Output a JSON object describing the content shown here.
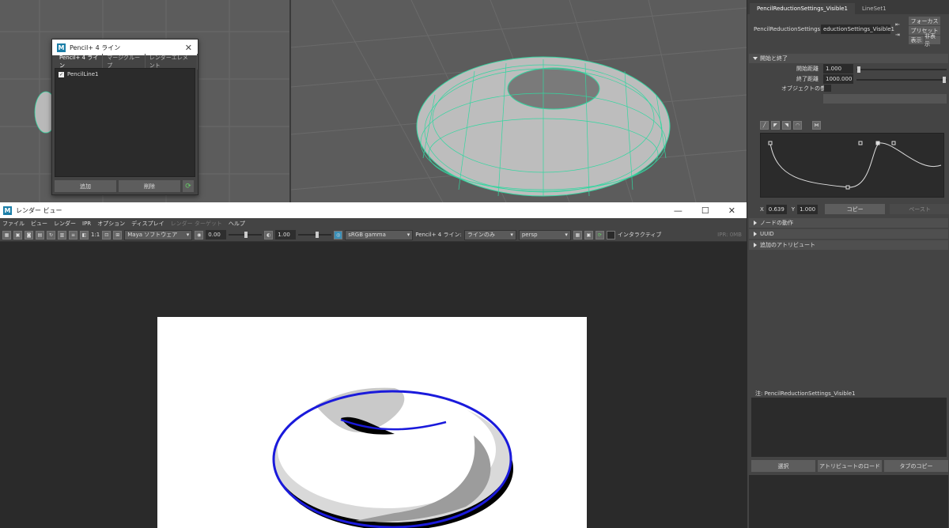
{
  "pencil_dialog": {
    "title": "Pencil+ 4 ライン",
    "tabs": [
      "Pencil+ 4 ライン",
      "マージグループ",
      "レンダーエレメント"
    ],
    "list_items": [
      {
        "label": "PencilLine1",
        "checked": true
      }
    ],
    "add_label": "追加",
    "delete_label": "削除"
  },
  "render_view": {
    "title": "レンダー ビュー",
    "menu": [
      "ファイル",
      "ビュー",
      "レンダー",
      "IPR",
      "オプション",
      "ディスプレイ",
      "レンダー ターゲット",
      "ヘルプ"
    ],
    "ratio_label": "1:1",
    "renderer": "Maya ソフトウェア",
    "exposure": "0.00",
    "gamma": "1.00",
    "color_space": "sRGB gamma",
    "pencil_label": "Pencil+ 4 ライン:",
    "line_mode": "ラインのみ",
    "camera": "persp",
    "interactive_label": "インタラクティブ",
    "ipr_label": "IPR: 0MB"
  },
  "attr_editor": {
    "tabs": [
      "PencilReductionSettings_Visible1",
      "LineSet1"
    ],
    "node_label": "PencilReductionSettings:",
    "node_value": "eductionSettings_Visible1",
    "focus_label": "フォーカス",
    "preset_label": "プリセット",
    "show_label": "表示",
    "hide_label": "非表示",
    "section_start_end": "開始と終了",
    "start_distance_label": "開始距離",
    "start_distance": "1.000",
    "end_distance_label": "終了距離",
    "end_distance": "1000.000",
    "object_ref_label": "オブジェクトの参照",
    "x_label": "X",
    "x_value": "0.639",
    "y_label": "Y",
    "y_value": "1.000",
    "copy_label": "コピー",
    "paste_label": "ペースト",
    "section_node_behavior": "ノードの動作",
    "section_uuid": "UUID",
    "section_extra_attrs": "追加のアトリビュート",
    "notes_label": "注: PencilReductionSettings_Visible1",
    "select_label": "選択",
    "load_attrs_label": "アトリビュートのロード",
    "copy_tab_label": "タブのコピー"
  },
  "colors": {
    "wireframe": "#33d6a0",
    "outline": "#1a1adb",
    "panel": "#444444"
  }
}
